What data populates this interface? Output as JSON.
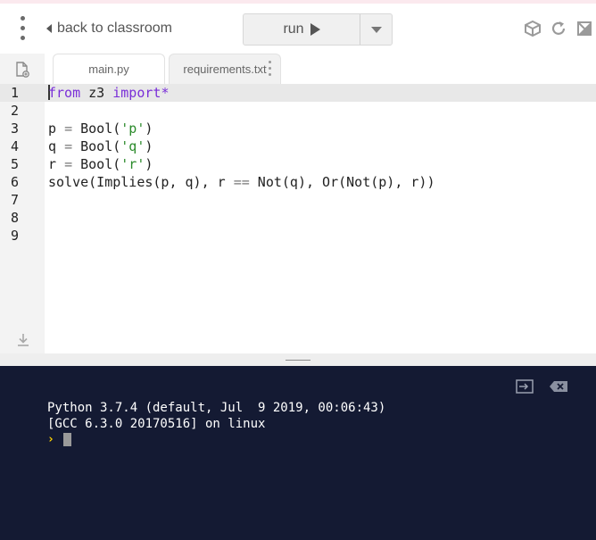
{
  "header": {
    "back_label": "back to classroom",
    "run_label": "run"
  },
  "tabs": [
    {
      "label": "main.py",
      "active": true
    },
    {
      "label": "requirements.txt",
      "active": false
    }
  ],
  "editor": {
    "line_numbers": [
      "1",
      "2",
      "3",
      "4",
      "5",
      "6",
      "7",
      "8",
      "9"
    ],
    "lines": [
      "from z3 import*",
      "",
      "p = Bool('p')",
      "q = Bool('q')",
      "r = Bool('r')",
      "solve(Implies(p, q), r == Not(q), Or(Not(p), r))",
      "",
      "",
      ""
    ]
  },
  "console": {
    "output": [
      "Python 3.7.4 (default, Jul  9 2019, 00:06:43)",
      "[GCC 6.3.0 20170516] on linux"
    ],
    "prompt": "›"
  },
  "colors": {
    "console_bg": "#141a33",
    "keyword": "#7a2fd8",
    "string": "#2a8a2a",
    "prompt": "#ffd400"
  }
}
